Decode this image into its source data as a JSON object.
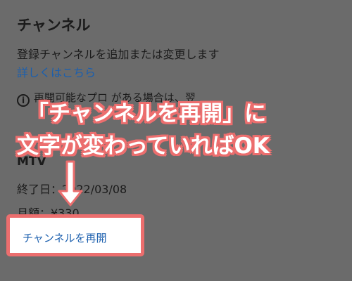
{
  "section": {
    "heading": "チャンネル",
    "description": "登録チャンネルを追加または変更します",
    "details_link": "詳しくはこちら",
    "notice_text": "再開可能なプロ                がある場合は、翌"
  },
  "subscription": {
    "name": "MTV",
    "end_date": "終了日：2022/03/08",
    "price": "月額：¥330"
  },
  "actions": {
    "restart_channel": "チャンネルを再開"
  },
  "annotation": {
    "line1": "「チャンネルを再開」に",
    "line2": "文字が変わっていればOK"
  },
  "colors": {
    "highlight": "#ec6e6e",
    "link": "#1b5fae",
    "overlay": "#6b6b6b"
  }
}
